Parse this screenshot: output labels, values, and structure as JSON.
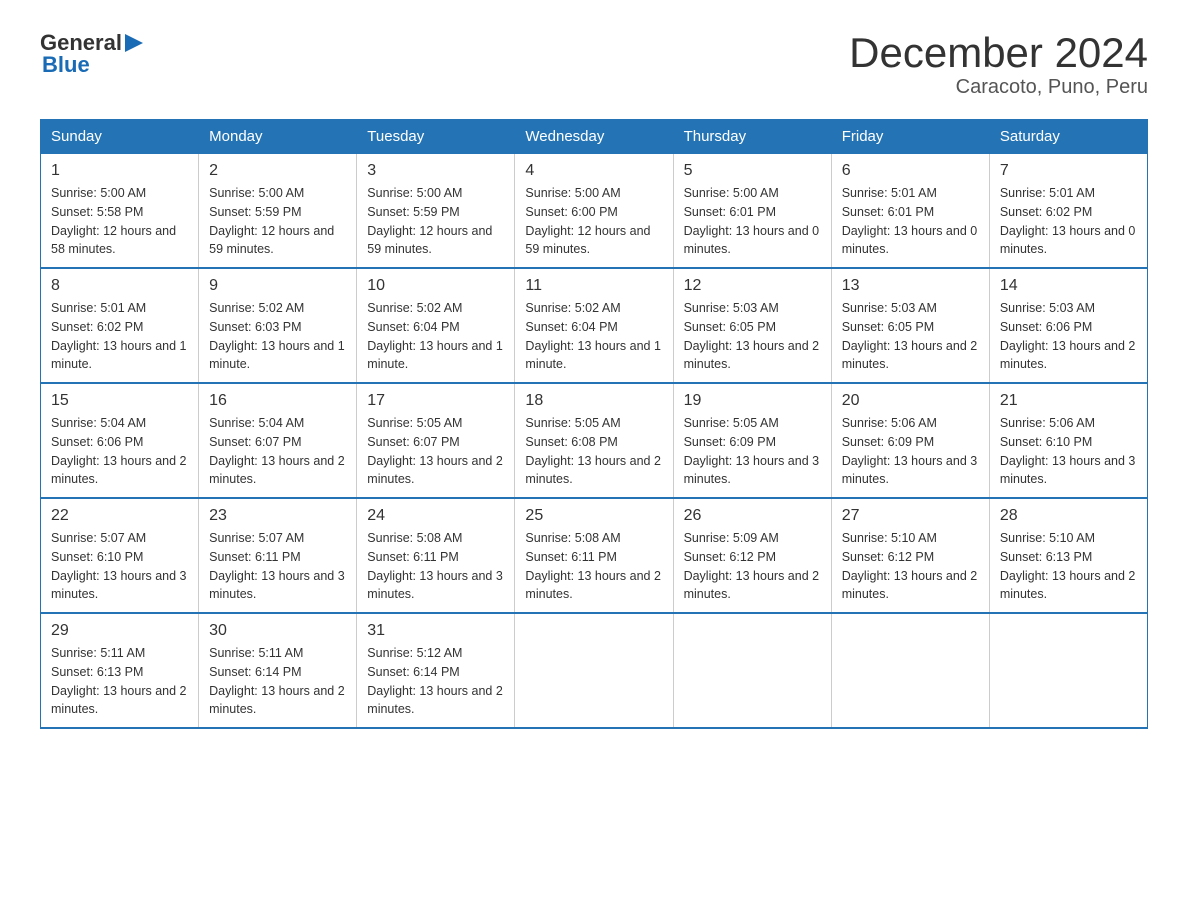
{
  "header": {
    "title": "December 2024",
    "subtitle": "Caracoto, Puno, Peru",
    "logo_general": "General",
    "logo_blue": "Blue"
  },
  "columns": [
    "Sunday",
    "Monday",
    "Tuesday",
    "Wednesday",
    "Thursday",
    "Friday",
    "Saturday"
  ],
  "weeks": [
    [
      {
        "day": "1",
        "sunrise": "5:00 AM",
        "sunset": "5:58 PM",
        "daylight": "12 hours and 58 minutes."
      },
      {
        "day": "2",
        "sunrise": "5:00 AM",
        "sunset": "5:59 PM",
        "daylight": "12 hours and 59 minutes."
      },
      {
        "day": "3",
        "sunrise": "5:00 AM",
        "sunset": "5:59 PM",
        "daylight": "12 hours and 59 minutes."
      },
      {
        "day": "4",
        "sunrise": "5:00 AM",
        "sunset": "6:00 PM",
        "daylight": "12 hours and 59 minutes."
      },
      {
        "day": "5",
        "sunrise": "5:00 AM",
        "sunset": "6:01 PM",
        "daylight": "13 hours and 0 minutes."
      },
      {
        "day": "6",
        "sunrise": "5:01 AM",
        "sunset": "6:01 PM",
        "daylight": "13 hours and 0 minutes."
      },
      {
        "day": "7",
        "sunrise": "5:01 AM",
        "sunset": "6:02 PM",
        "daylight": "13 hours and 0 minutes."
      }
    ],
    [
      {
        "day": "8",
        "sunrise": "5:01 AM",
        "sunset": "6:02 PM",
        "daylight": "13 hours and 1 minute."
      },
      {
        "day": "9",
        "sunrise": "5:02 AM",
        "sunset": "6:03 PM",
        "daylight": "13 hours and 1 minute."
      },
      {
        "day": "10",
        "sunrise": "5:02 AM",
        "sunset": "6:04 PM",
        "daylight": "13 hours and 1 minute."
      },
      {
        "day": "11",
        "sunrise": "5:02 AM",
        "sunset": "6:04 PM",
        "daylight": "13 hours and 1 minute."
      },
      {
        "day": "12",
        "sunrise": "5:03 AM",
        "sunset": "6:05 PM",
        "daylight": "13 hours and 2 minutes."
      },
      {
        "day": "13",
        "sunrise": "5:03 AM",
        "sunset": "6:05 PM",
        "daylight": "13 hours and 2 minutes."
      },
      {
        "day": "14",
        "sunrise": "5:03 AM",
        "sunset": "6:06 PM",
        "daylight": "13 hours and 2 minutes."
      }
    ],
    [
      {
        "day": "15",
        "sunrise": "5:04 AM",
        "sunset": "6:06 PM",
        "daylight": "13 hours and 2 minutes."
      },
      {
        "day": "16",
        "sunrise": "5:04 AM",
        "sunset": "6:07 PM",
        "daylight": "13 hours and 2 minutes."
      },
      {
        "day": "17",
        "sunrise": "5:05 AM",
        "sunset": "6:07 PM",
        "daylight": "13 hours and 2 minutes."
      },
      {
        "day": "18",
        "sunrise": "5:05 AM",
        "sunset": "6:08 PM",
        "daylight": "13 hours and 2 minutes."
      },
      {
        "day": "19",
        "sunrise": "5:05 AM",
        "sunset": "6:09 PM",
        "daylight": "13 hours and 3 minutes."
      },
      {
        "day": "20",
        "sunrise": "5:06 AM",
        "sunset": "6:09 PM",
        "daylight": "13 hours and 3 minutes."
      },
      {
        "day": "21",
        "sunrise": "5:06 AM",
        "sunset": "6:10 PM",
        "daylight": "13 hours and 3 minutes."
      }
    ],
    [
      {
        "day": "22",
        "sunrise": "5:07 AM",
        "sunset": "6:10 PM",
        "daylight": "13 hours and 3 minutes."
      },
      {
        "day": "23",
        "sunrise": "5:07 AM",
        "sunset": "6:11 PM",
        "daylight": "13 hours and 3 minutes."
      },
      {
        "day": "24",
        "sunrise": "5:08 AM",
        "sunset": "6:11 PM",
        "daylight": "13 hours and 3 minutes."
      },
      {
        "day": "25",
        "sunrise": "5:08 AM",
        "sunset": "6:11 PM",
        "daylight": "13 hours and 2 minutes."
      },
      {
        "day": "26",
        "sunrise": "5:09 AM",
        "sunset": "6:12 PM",
        "daylight": "13 hours and 2 minutes."
      },
      {
        "day": "27",
        "sunrise": "5:10 AM",
        "sunset": "6:12 PM",
        "daylight": "13 hours and 2 minutes."
      },
      {
        "day": "28",
        "sunrise": "5:10 AM",
        "sunset": "6:13 PM",
        "daylight": "13 hours and 2 minutes."
      }
    ],
    [
      {
        "day": "29",
        "sunrise": "5:11 AM",
        "sunset": "6:13 PM",
        "daylight": "13 hours and 2 minutes."
      },
      {
        "day": "30",
        "sunrise": "5:11 AM",
        "sunset": "6:14 PM",
        "daylight": "13 hours and 2 minutes."
      },
      {
        "day": "31",
        "sunrise": "5:12 AM",
        "sunset": "6:14 PM",
        "daylight": "13 hours and 2 minutes."
      },
      null,
      null,
      null,
      null
    ]
  ],
  "colors": {
    "header_bg": "#2474b5",
    "header_text": "#ffffff",
    "border": "#2474b5",
    "body_text": "#333333"
  }
}
